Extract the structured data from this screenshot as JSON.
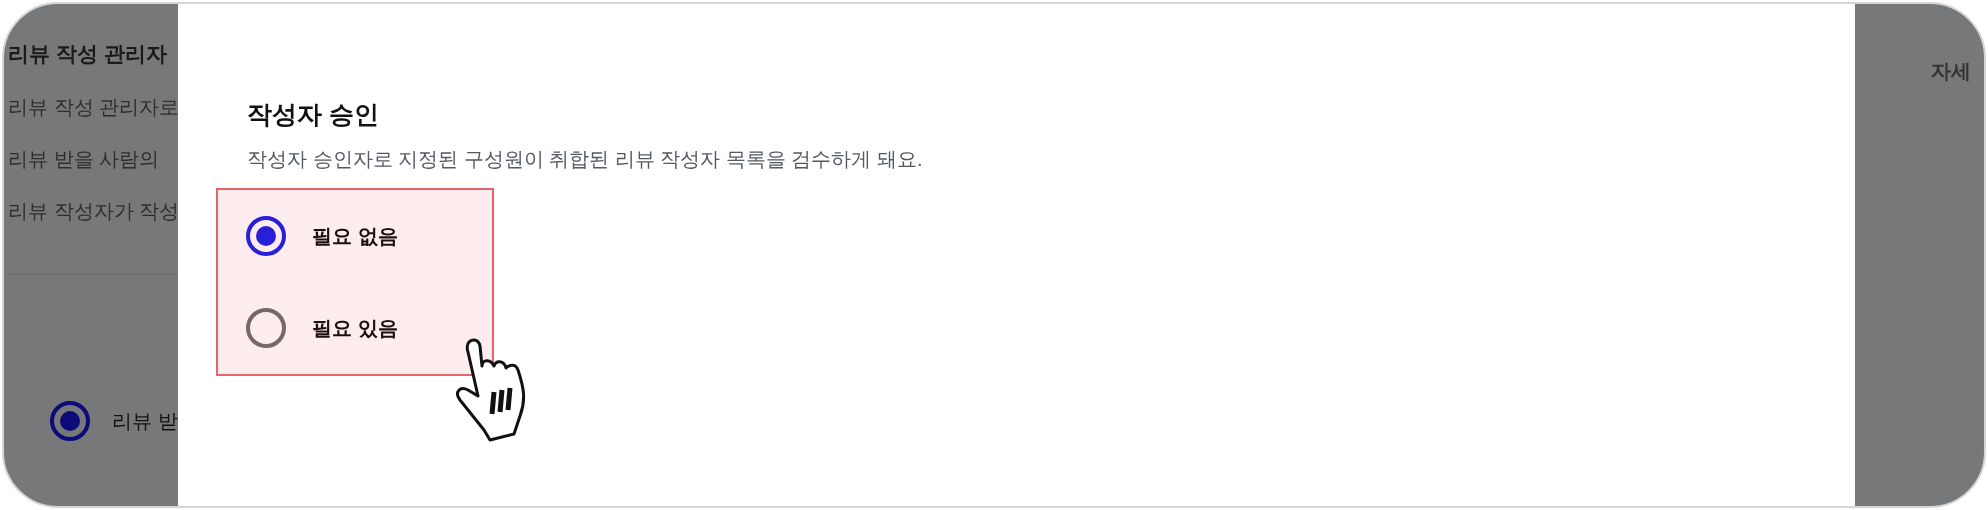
{
  "background": {
    "title": "리뷰 작성 관리자",
    "lines": [
      "리뷰 작성 관리자로",
      "리뷰 받을 사람의",
      "리뷰 작성자가 작성"
    ],
    "option": {
      "label": "리뷰 받",
      "selected": true
    },
    "side_title": "자세"
  },
  "dialog": {
    "title": "작성자 승인",
    "description": "작성자 승인자로 지정된 구성원이 취합된 리뷰 작성자 목록을 검수하게 돼요.",
    "options": [
      {
        "label": "필요 없음",
        "selected": true
      },
      {
        "label": "필요 있음",
        "selected": false
      }
    ]
  }
}
